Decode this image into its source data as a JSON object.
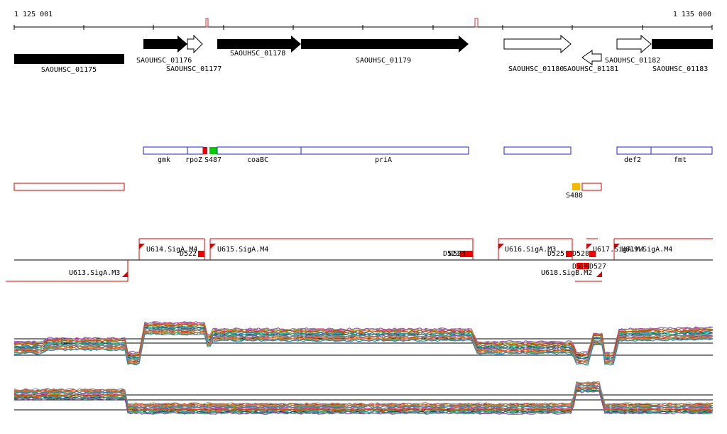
{
  "ruler": {
    "start_label": "1 125 001",
    "end_label": "1 135 000"
  },
  "genes": [
    {
      "label": "SAOUHSC_01175",
      "strand": "none",
      "fill": "black"
    },
    {
      "label": "SAOUHSC_01176",
      "strand": "+",
      "fill": "black"
    },
    {
      "label": "SAOUHSC_01177",
      "strand": "+",
      "fill": "white"
    },
    {
      "label": "SAOUHSC_01178",
      "strand": "+",
      "fill": "black"
    },
    {
      "label": "SAOUHSC_01179",
      "strand": "+",
      "fill": "black"
    },
    {
      "label": "SAOUHSC_01180",
      "strand": "+",
      "fill": "white"
    },
    {
      "label": "SAOUHSC_01181",
      "strand": "-",
      "fill": "white"
    },
    {
      "label": "SAOUHSC_01182",
      "strand": "+",
      "fill": "white"
    },
    {
      "label": "SAOUHSC_01183",
      "strand": "none",
      "fill": "black"
    }
  ],
  "gene_names": [
    "gmk",
    "rpoZ",
    "S487",
    "coaBC",
    "priA",
    "def2",
    "fmt"
  ],
  "lower_features": [
    "S488"
  ],
  "segments": [
    "U613.SigA.M3",
    "U614.SigA.M4",
    "U615.SigA.M4",
    "U616.SigA.M3",
    "U617.SigA.M4",
    "U618.SigB.M2",
    "U619.SigA.M4"
  ],
  "small_features": [
    "D522",
    "D523",
    "D524",
    "D525",
    "D526",
    "D527",
    "D528"
  ],
  "colors": {
    "gene_box": "#2222cc",
    "feature_red": "#ee0000",
    "feature_green": "#00cc00",
    "feature_orange": "#f5b800",
    "segment_line": "#dd0000",
    "outline_red": "#cc0000"
  }
}
